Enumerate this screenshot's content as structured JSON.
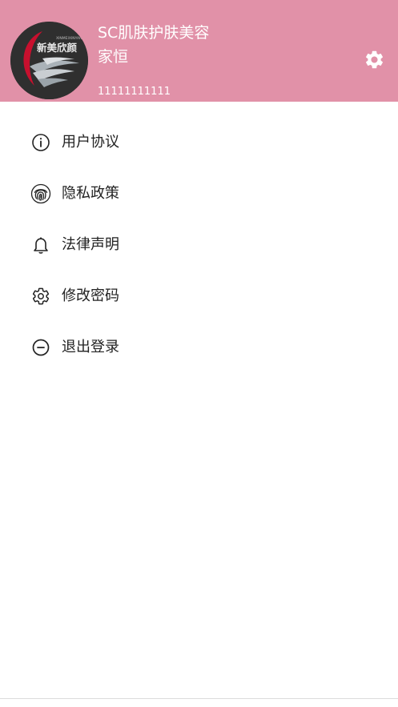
{
  "header": {
    "shop_name": "SC肌肤护肤美容",
    "user_name": "家恒",
    "phone": "11111111111",
    "background_color": "#e191a8",
    "settings_icon": "gear-icon",
    "avatar_logo_text": "新美欣颜",
    "avatar_logo_small_text": "XINMEIXINYAN"
  },
  "menu": {
    "items": [
      {
        "label": "用户协议",
        "icon": "info-circle-icon"
      },
      {
        "label": "隐私政策",
        "icon": "fingerprint-icon"
      },
      {
        "label": "法律声明",
        "icon": "bell-icon"
      },
      {
        "label": "修改密码",
        "icon": "gear-outline-icon"
      },
      {
        "label": "退出登录",
        "icon": "minus-circle-icon"
      }
    ]
  }
}
